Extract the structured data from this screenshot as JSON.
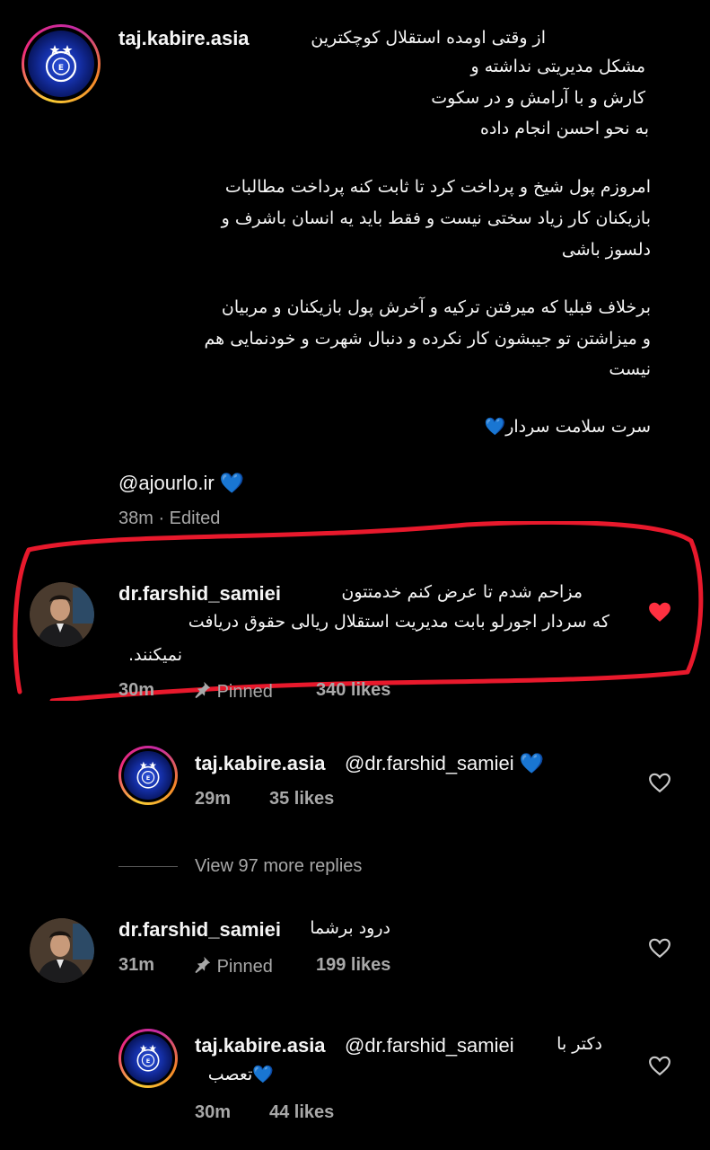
{
  "caption": {
    "username": "taj.kabire.asia",
    "lines": [
      "از وقتی اومده استقلال کوچکترین",
      "مشکل مدیریتی نداشته و",
      "کارش و با آرامش و در سکوت",
      "به نحو احسن انجام داده",
      "امروزم پول شیخ و پرداخت کرد تا ثابت کنه پرداخت مطالبات",
      "بازیکنان کار زیاد سختی نیست و فقط باید یه انسان باشرف و",
      "دلسوز باشی",
      "برخلاف قبلیا که میرفتن ترکیه و آخرش پول بازیکنان و مربیان",
      "و میزاشتن تو جیبشون کار نکرده و دنبال شهرت و خودنمایی هم",
      "نیست",
      "سرت سلامت سردار💙"
    ],
    "mention": "@ajourlo.ir 💙",
    "time": "38m",
    "edited": "· Edited"
  },
  "comment1": {
    "username": "dr.farshid_samiei",
    "lines": [
      "مزاحم شدم تا عرض کنم خدمتتون",
      "که سردار اجورلو بابت مدیریت استقلال ریالی حقوق دریافت",
      "نمیکنند."
    ],
    "time": "30m",
    "pinned": "Pinned",
    "likes": "340 likes",
    "liked": true
  },
  "reply1": {
    "username": "taj.kabire.asia",
    "text": "@dr.farshid_samiei 💙",
    "time": "29m",
    "likes": "35 likes"
  },
  "view_replies": "View 97 more replies",
  "comment2": {
    "username": "dr.farshid_samiei",
    "text": "درود برشما",
    "time": "31m",
    "pinned": "Pinned",
    "likes": "199 likes"
  },
  "reply2": {
    "username": "taj.kabire.asia",
    "text_mention": "@dr.farshid_samiei",
    "text_fa": "دکتر با",
    "text_line2": "💙تعصب",
    "time": "30m",
    "likes": "44 likes"
  },
  "colors": {
    "background": "#000000",
    "text": "#f5f5f5",
    "muted": "#a8a8a8",
    "like_red": "#ff3040",
    "highlight_red": "#e8192c"
  }
}
